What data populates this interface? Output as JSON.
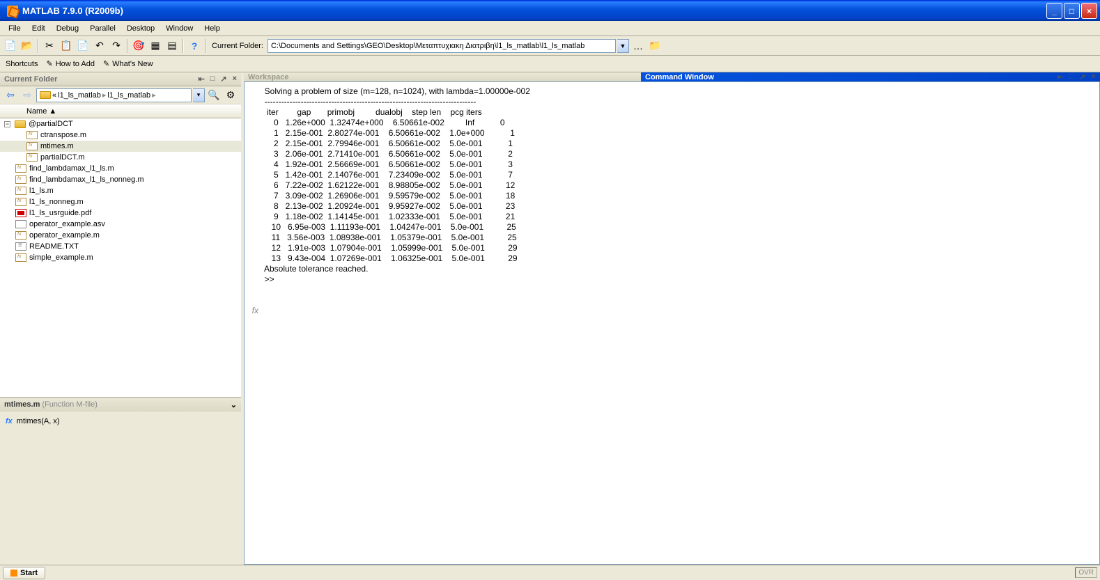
{
  "title": "MATLAB  7.9.0 (R2009b)",
  "menu": [
    "File",
    "Edit",
    "Debug",
    "Parallel",
    "Desktop",
    "Window",
    "Help"
  ],
  "currentFolderLabel": "Current Folder:",
  "currentFolderPath": "C:\\Documents and Settings\\GEO\\Desktop\\Μεταπτυχιακη Διατριβη\\l1_ls_matlab\\l1_ls_matlab",
  "shortcuts": {
    "label": "Shortcuts",
    "howToAdd": "How to Add",
    "whatsNew": "What's New"
  },
  "leftPaneTitle": "Current Folder",
  "breadcrumb": {
    "prefix": "«",
    "p1": "l1_ls_matlab",
    "p2": "l1_ls_matlab"
  },
  "nameHeader": "Name ▲",
  "tree": {
    "folder": "@partialDCT",
    "folderFiles": [
      "ctranspose.m",
      "mtimes.m",
      "partialDCT.m"
    ],
    "rootFiles": [
      {
        "n": "find_lambdamax_l1_ls.m",
        "t": "mfile"
      },
      {
        "n": "find_lambdamax_l1_ls_nonneg.m",
        "t": "mfile"
      },
      {
        "n": "l1_ls.m",
        "t": "mfile"
      },
      {
        "n": "l1_ls_nonneg.m",
        "t": "mfile"
      },
      {
        "n": "l1_ls_usrguide.pdf",
        "t": "pdf"
      },
      {
        "n": "operator_example.asv",
        "t": "asv"
      },
      {
        "n": "operator_example.m",
        "t": "mfile"
      },
      {
        "n": "README.TXT",
        "t": "txt"
      },
      {
        "n": "simple_example.m",
        "t": "mfile"
      }
    ],
    "selected": "mtimes.m"
  },
  "details": {
    "filename": "mtimes.m",
    "type": "(Function M-file)",
    "sig": "mtimes(A, x)"
  },
  "workspaceTitle": "Workspace",
  "cmdTitle": "Command Window",
  "cmdOutput": {
    "header": "Solving a problem of size (m=128, n=1024), with lambda=1.00000e-002",
    "sep": "----------------------------------------------------------------------------",
    "colHeader": " iter        gap       primobj         dualobj    step len    pcg iters",
    "rows": [
      "    0   1.26e+000  1.32474e+000    6.50661e-002         Inf           0",
      "    1   2.15e-001  2.80274e-001    6.50661e-002    1.0e+000           1",
      "    2   2.15e-001  2.79946e-001    6.50661e-002    5.0e-001           1",
      "    3   2.06e-001  2.71410e-001    6.50661e-002    5.0e-001           2",
      "    4   1.92e-001  2.56669e-001    6.50661e-002    5.0e-001           3",
      "    5   1.42e-001  2.14076e-001    7.23409e-002    5.0e-001           7",
      "    6   7.22e-002  1.62122e-001    8.98805e-002    5.0e-001          12",
      "    7   3.09e-002  1.26906e-001    9.59579e-002    5.0e-001          18",
      "    8   2.13e-002  1.20924e-001    9.95927e-002    5.0e-001          23",
      "    9   1.18e-002  1.14145e-001    1.02333e-001    5.0e-001          21",
      "   10   6.95e-003  1.11193e-001    1.04247e-001    5.0e-001          25",
      "   11   3.56e-003  1.08938e-001    1.05379e-001    5.0e-001          25",
      "   12   1.91e-003  1.07904e-001    1.05999e-001    5.0e-001          29",
      "   13   9.43e-004  1.07269e-001    1.06325e-001    5.0e-001          29"
    ],
    "footer": "Absolute tolerance reached.",
    "prompt": ">> "
  },
  "startLabel": "Start",
  "ovrLabel": "OVR"
}
